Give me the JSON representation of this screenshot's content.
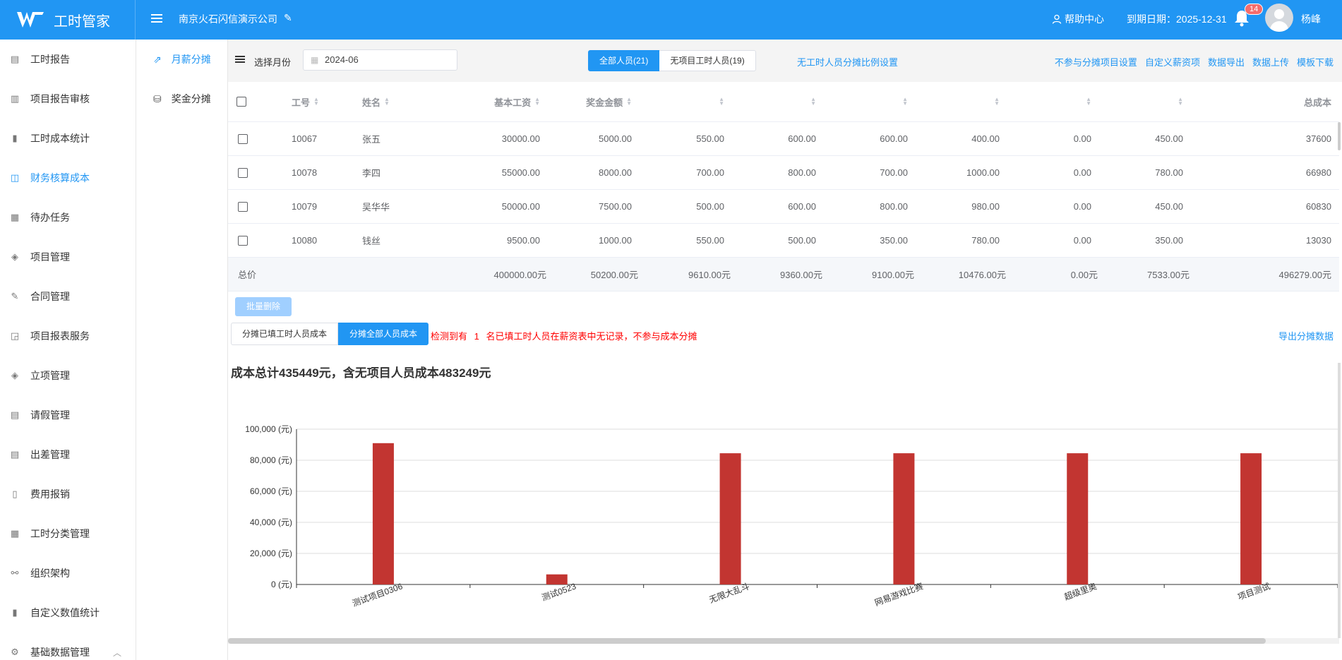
{
  "app": {
    "name": "工时管家",
    "company": "南京火石闪信演示公司",
    "help": "帮助中心",
    "expire": "到期日期：2025-12-31",
    "notifications": "14",
    "user": "杨峰"
  },
  "sidebar": {
    "items": [
      {
        "label": "工时报告",
        "icon": "report-icon"
      },
      {
        "label": "项目报告审核",
        "icon": "audit-icon"
      },
      {
        "label": "工时成本统计",
        "icon": "bar-chart-icon"
      },
      {
        "label": "财务核算成本",
        "icon": "finance-icon",
        "active": true
      },
      {
        "label": "待办任务",
        "icon": "todo-icon"
      },
      {
        "label": "项目管理",
        "icon": "layers-icon"
      },
      {
        "label": "合同管理",
        "icon": "contract-icon"
      },
      {
        "label": "项目报表服务",
        "icon": "report-chart-icon"
      },
      {
        "label": "立项管理",
        "icon": "layers-icon"
      },
      {
        "label": "请假管理",
        "icon": "leave-icon"
      },
      {
        "label": "出差管理",
        "icon": "trip-icon"
      },
      {
        "label": "费用报销",
        "icon": "expense-icon"
      },
      {
        "label": "工时分类管理",
        "icon": "category-icon"
      },
      {
        "label": "组织架构",
        "icon": "org-icon"
      },
      {
        "label": "自定义数值统计",
        "icon": "bar-chart-icon"
      },
      {
        "label": "基础数据管理",
        "icon": "gear-icon"
      }
    ]
  },
  "subnav": {
    "items": [
      {
        "label": "月薪分摊",
        "active": true
      },
      {
        "label": "奖金分摊"
      }
    ]
  },
  "filter": {
    "month_label": "选择月份",
    "month_value": "2024-06",
    "seg_all": "全部人员(21)",
    "seg_none": "无项目工时人员(19)",
    "ratio_link": "无工时人员分摊比例设置",
    "links": [
      "不参与分摊项目设置",
      "自定义薪资项",
      "数据导出",
      "数据上传",
      "模板下载"
    ]
  },
  "table": {
    "headers": {
      "no": "工号",
      "name": "姓名",
      "base": "基本工资",
      "bonus": "奖金金额",
      "total": "总成本"
    },
    "rows": [
      [
        "10067",
        "张五",
        "30000.00",
        "5000.00",
        "550.00",
        "600.00",
        "600.00",
        "400.00",
        "0.00",
        "450.00",
        "37600"
      ],
      [
        "10078",
        "李四",
        "55000.00",
        "8000.00",
        "700.00",
        "800.00",
        "700.00",
        "1000.00",
        "0.00",
        "780.00",
        "66980"
      ],
      [
        "10079",
        "吴华华",
        "50000.00",
        "7500.00",
        "500.00",
        "600.00",
        "800.00",
        "980.00",
        "0.00",
        "450.00",
        "60830"
      ],
      [
        "10080",
        "钱丝",
        "9500.00",
        "1000.00",
        "550.00",
        "500.00",
        "350.00",
        "780.00",
        "0.00",
        "350.00",
        "13030"
      ]
    ],
    "total_label": "总价",
    "totals": [
      "400000.00元",
      "50200.00元",
      "9610.00元",
      "9360.00元",
      "9100.00元",
      "10476.00元",
      "0.00元",
      "7533.00元",
      "496279.00元"
    ]
  },
  "actions": {
    "batch_delete": "批量删除",
    "alloc_filled": "分摊已填工时人员成本",
    "alloc_all": "分摊全部人员成本",
    "warning_pre": "检测到有",
    "warning_count": "1",
    "warning_post": "名已填工时人员在薪资表中无记录，不参与成本分摊",
    "export_alloc": "导出分摊数据"
  },
  "chart_data": {
    "type": "bar",
    "title": "成本总计435449元，含无项目人员成本483249元",
    "categories": [
      "测试项目0306",
      "测试0523",
      "无限大乱斗",
      "网易游戏比赛",
      "超级里奥",
      "项目测试"
    ],
    "values": [
      91000,
      6500,
      84500,
      84500,
      84500,
      84500
    ],
    "ylim": [
      0,
      100000
    ],
    "yticks": [
      "0 (元)",
      "20,000 (元)",
      "40,000 (元)",
      "60,000 (元)",
      "80,000 (元)",
      "100,000 (元)"
    ],
    "bar_color": "#c23531",
    "grid": true
  }
}
